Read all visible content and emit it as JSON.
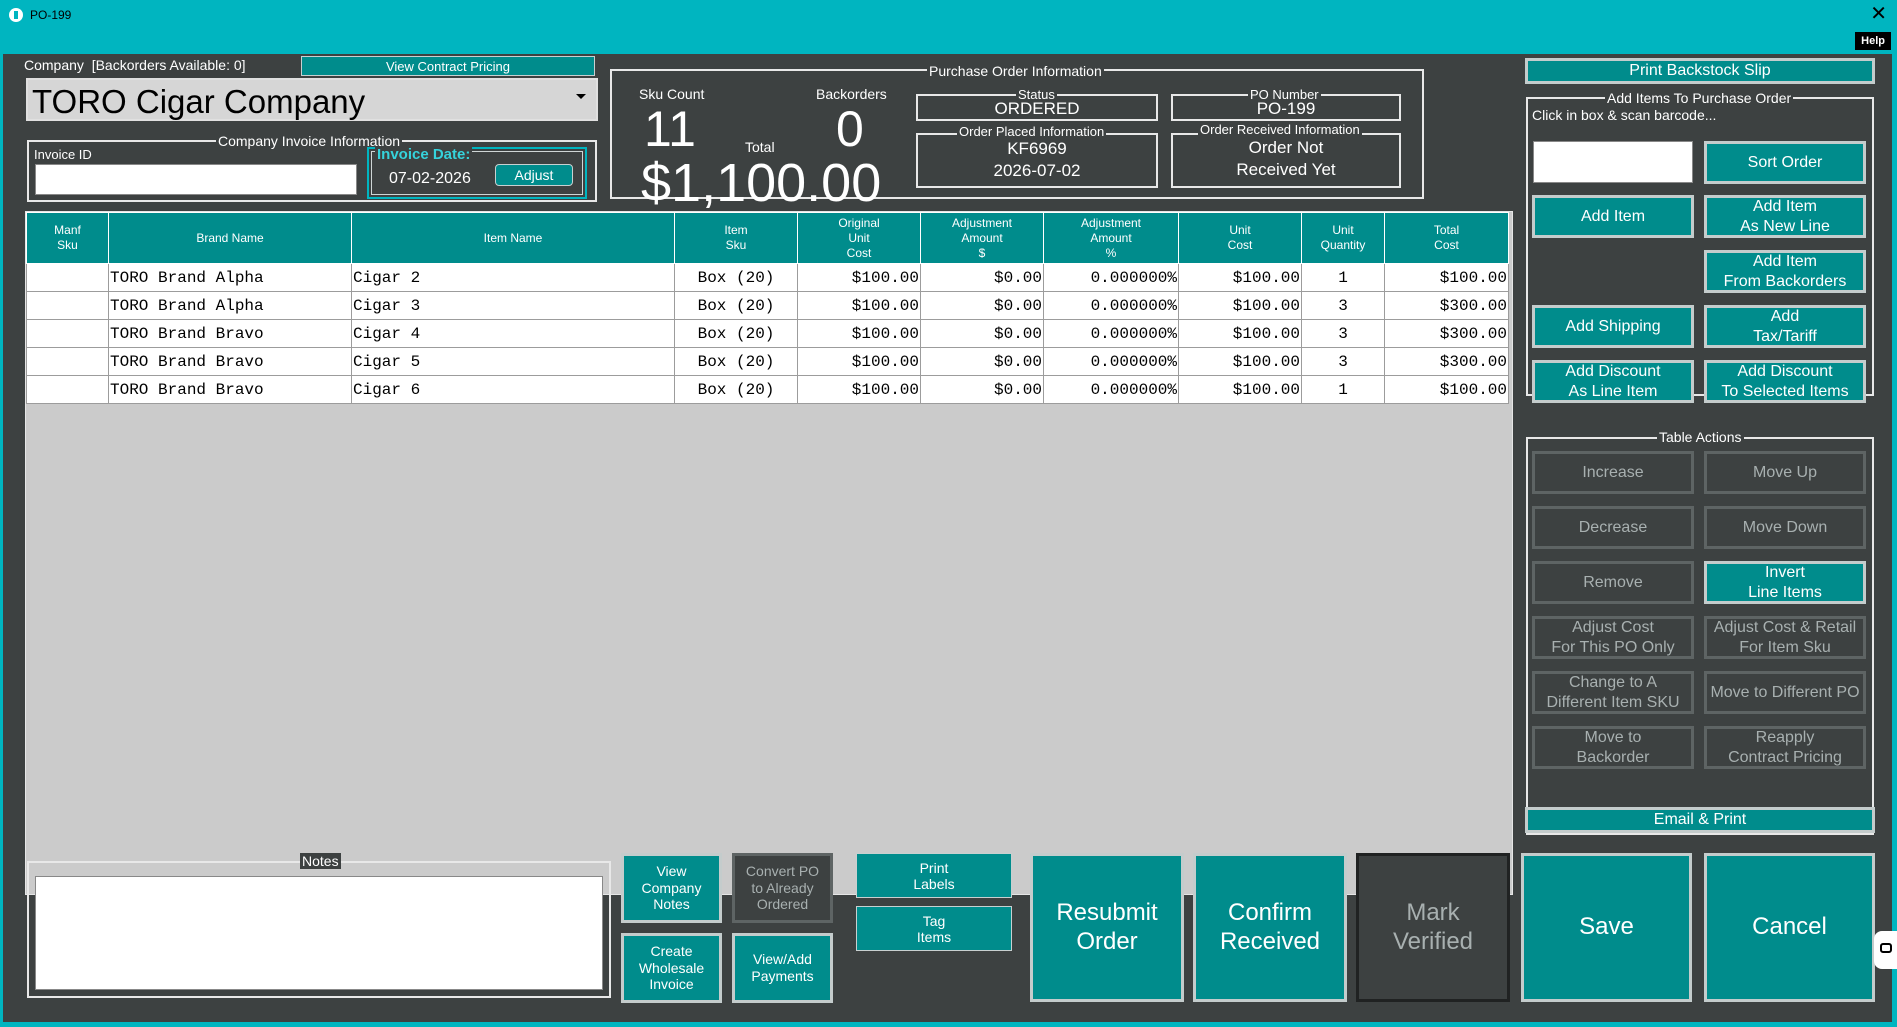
{
  "window": {
    "title": "PO-199",
    "help_label": "Help"
  },
  "company": {
    "label": "Company",
    "backorders_label": "[Backorders Available: 0]",
    "view_contract_pricing": "View Contract Pricing",
    "selected": "TORO Cigar Company"
  },
  "invoice": {
    "group_title": "Company Invoice Information",
    "invoice_id_label": "Invoice ID",
    "invoice_id_value": "",
    "invoice_date_label": "Invoice Date:",
    "invoice_date_value": "07-02-2026",
    "adjust_label": "Adjust"
  },
  "summary": {
    "sku_count_label": "Sku Count",
    "sku_count": "11",
    "backorders_label": "Backorders",
    "backorders": "0",
    "total_label": "Total",
    "total": "$1,100.00"
  },
  "po_info": {
    "group_title": "Purchase Order Information",
    "status_label": "Status",
    "status": "ORDERED",
    "po_number_label": "PO Number",
    "po_number": "PO-199",
    "placed_label": "Order Placed Information",
    "placed_line1": "KF6969",
    "placed_line2": "2026-07-02",
    "received_label": "Order Received Information",
    "received_line1": "Order Not",
    "received_line2": "Received Yet"
  },
  "table": {
    "headers": [
      [
        "Manf",
        "Sku"
      ],
      [
        "Brand Name"
      ],
      [
        "Item Name"
      ],
      [
        "Item",
        "Sku"
      ],
      [
        "Original",
        "Unit",
        "Cost"
      ],
      [
        "Adjustment",
        "Amount",
        "$"
      ],
      [
        "Adjustment",
        "Amount",
        "%"
      ],
      [
        "Unit",
        "Cost"
      ],
      [
        "Unit",
        "Quantity"
      ],
      [
        "Total",
        "Cost"
      ]
    ],
    "rows": [
      [
        "",
        "TORO Brand Alpha",
        "Cigar 2",
        "Box (20)",
        "$100.00",
        "$0.00",
        "0.000000%",
        "$100.00",
        "1",
        "$100.00"
      ],
      [
        "",
        "TORO Brand Alpha",
        "Cigar 3",
        "Box (20)",
        "$100.00",
        "$0.00",
        "0.000000%",
        "$100.00",
        "3",
        "$300.00"
      ],
      [
        "",
        "TORO Brand Bravo",
        "Cigar 4",
        "Box (20)",
        "$100.00",
        "$0.00",
        "0.000000%",
        "$100.00",
        "3",
        "$300.00"
      ],
      [
        "",
        "TORO Brand Bravo",
        "Cigar 5",
        "Box (20)",
        "$100.00",
        "$0.00",
        "0.000000%",
        "$100.00",
        "3",
        "$300.00"
      ],
      [
        "",
        "TORO Brand Bravo",
        "Cigar 6",
        "Box (20)",
        "$100.00",
        "$0.00",
        "0.000000%",
        "$100.00",
        "1",
        "$100.00"
      ]
    ]
  },
  "right_panel": {
    "print_backstock_slip": "Print Backstock Slip",
    "add_items_title": "Add Items To Purchase Order",
    "scan_hint": "Click in box & scan barcode...",
    "sort_order": "Sort Order",
    "add_item": "Add Item",
    "add_item_new_line": [
      "Add Item",
      "As New Line"
    ],
    "add_item_backorders": [
      "Add Item",
      "From Backorders"
    ],
    "add_shipping": "Add Shipping",
    "add_tax": [
      "Add",
      "Tax/Tariff"
    ],
    "add_discount_line": [
      "Add Discount",
      "As Line Item"
    ],
    "add_discount_selected": [
      "Add Discount",
      "To Selected Items"
    ],
    "table_actions_title": "Table Actions",
    "increase": "Increase",
    "move_up": "Move Up",
    "decrease": "Decrease",
    "move_down": "Move Down",
    "remove": "Remove",
    "invert": [
      "Invert",
      "Line Items"
    ],
    "adjust_cost_po": [
      "Adjust Cost",
      "For This PO Only"
    ],
    "adjust_cost_retail": [
      "Adjust Cost & Retail",
      "For Item Sku"
    ],
    "change_sku": [
      "Change to A",
      "Different Item SKU"
    ],
    "move_to_po": "Move to Different PO",
    "move_to_backorder": [
      "Move to",
      "Backorder"
    ],
    "reapply_pricing": [
      "Reapply",
      "Contract Pricing"
    ],
    "email_print": "Email & Print"
  },
  "notes": {
    "title": "Notes",
    "value": ""
  },
  "bottom": {
    "view_company_notes": [
      "View",
      "Company",
      "Notes"
    ],
    "convert_po": [
      "Convert PO",
      "to Already",
      "Ordered"
    ],
    "create_wholesale": [
      "Create",
      "Wholesale",
      "Invoice"
    ],
    "view_payments": [
      "View/Add",
      "Payments"
    ],
    "print_labels": [
      "Print",
      "Labels"
    ],
    "tag_items": [
      "Tag",
      "Items"
    ],
    "resubmit": [
      "Resubmit",
      "Order"
    ],
    "confirm_received": [
      "Confirm",
      "Received"
    ],
    "mark_verified": [
      "Mark",
      "Verified"
    ],
    "save": "Save",
    "cancel": "Cancel"
  },
  "colors": {
    "accent": "#008c8c",
    "background": "#3d4141",
    "titlebar": "#00b5c0"
  },
  "icons": {
    "close": "close-icon",
    "dropdown": "chevron-down-icon",
    "side_tab": "side-tab-icon"
  }
}
